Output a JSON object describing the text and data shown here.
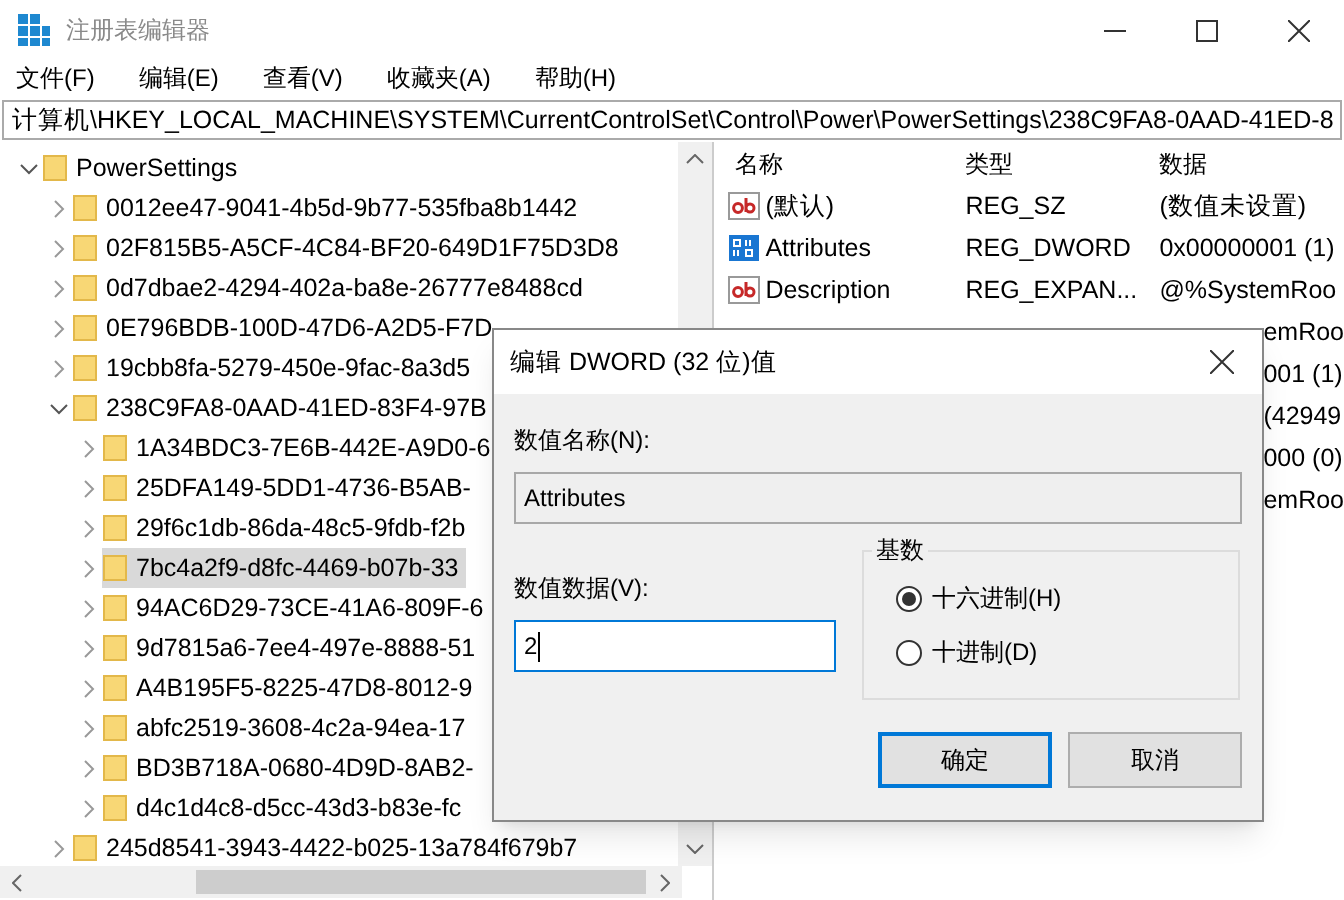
{
  "window": {
    "title": "注册表编辑器"
  },
  "menu": [
    "文件(F)",
    "编辑(E)",
    "查看(V)",
    "收藏夹(A)",
    "帮助(H)"
  ],
  "address_bar": {
    "path": "计算机\\HKEY_LOCAL_MACHINE\\SYSTEM\\CurrentControlSet\\Control\\Power\\PowerSettings\\238C9FA8-0AAD-41ED-8"
  },
  "tree": {
    "items": [
      {
        "label": "PowerSettings",
        "expanded": true,
        "selected": false,
        "children": [
          {
            "label": "0012ee47-9041-4b5d-9b77-535fba8b1442",
            "expanded": false,
            "selected": false
          },
          {
            "label": "02F815B5-A5CF-4C84-BF20-649D1F75D3D8",
            "expanded": false,
            "selected": false
          },
          {
            "label": "0d7dbae2-4294-402a-ba8e-26777e8488cd",
            "expanded": false,
            "selected": false
          },
          {
            "label": "0E796BDB-100D-47D6-A2D5-F7D",
            "expanded": false,
            "selected": false
          },
          {
            "label": "19cbb8fa-5279-450e-9fac-8a3d5",
            "expanded": false,
            "selected": false
          },
          {
            "label": "238C9FA8-0AAD-41ED-83F4-97B",
            "expanded": true,
            "selected": false,
            "children": [
              {
                "label": "1A34BDC3-7E6B-442E-A9D0-6",
                "expanded": false,
                "selected": false
              },
              {
                "label": "25DFA149-5DD1-4736-B5AB-",
                "expanded": false,
                "selected": false
              },
              {
                "label": "29f6c1db-86da-48c5-9fdb-f2b",
                "expanded": false,
                "selected": false
              },
              {
                "label": "7bc4a2f9-d8fc-4469-b07b-33",
                "expanded": false,
                "selected": true
              },
              {
                "label": "94AC6D29-73CE-41A6-809F-6",
                "expanded": false,
                "selected": false
              },
              {
                "label": "9d7815a6-7ee4-497e-8888-51",
                "expanded": false,
                "selected": false
              },
              {
                "label": "A4B195F5-8225-47D8-8012-9",
                "expanded": false,
                "selected": false
              },
              {
                "label": "abfc2519-3608-4c2a-94ea-17",
                "expanded": false,
                "selected": false
              },
              {
                "label": "BD3B718A-0680-4D9D-8AB2-",
                "expanded": false,
                "selected": false
              },
              {
                "label": "d4c1d4c8-d5cc-43d3-b83e-fc",
                "expanded": false,
                "selected": false
              }
            ]
          },
          {
            "label": "245d8541-3943-4422-b025-13a784f679b7",
            "expanded": false,
            "selected": false
          }
        ]
      }
    ]
  },
  "values": {
    "columns": [
      "名称",
      "类型",
      "数据"
    ],
    "rows": [
      {
        "kind": "string",
        "name": "(默认)",
        "type": "REG_SZ",
        "data": "(数值未设置)"
      },
      {
        "kind": "binary",
        "name": "Attributes",
        "type": "REG_DWORD",
        "data": "0x00000001 (1)"
      },
      {
        "kind": "string",
        "name": "Description",
        "type": "REG_EXPAN...",
        "data": "@%SystemRoo"
      },
      {
        "kind": "partial",
        "data": "emRoo"
      },
      {
        "kind": "partial",
        "data": "001 (1)"
      },
      {
        "kind": "partial",
        "data": "(42949"
      },
      {
        "kind": "partial",
        "data": "000 (0)"
      },
      {
        "kind": "partial",
        "data": "emRoo"
      }
    ]
  },
  "dialog": {
    "title": "编辑 DWORD (32 位)值",
    "name_label": "数值名称(N):",
    "name_value": "Attributes",
    "data_label": "数值数据(V):",
    "data_value": "2",
    "base": {
      "title": "基数",
      "options": [
        {
          "label": "十六进制(H)",
          "selected": true
        },
        {
          "label": "十进制(D)",
          "selected": false
        }
      ]
    },
    "buttons": [
      {
        "label": "确定",
        "default": true
      },
      {
        "label": "取消",
        "default": false
      }
    ]
  }
}
